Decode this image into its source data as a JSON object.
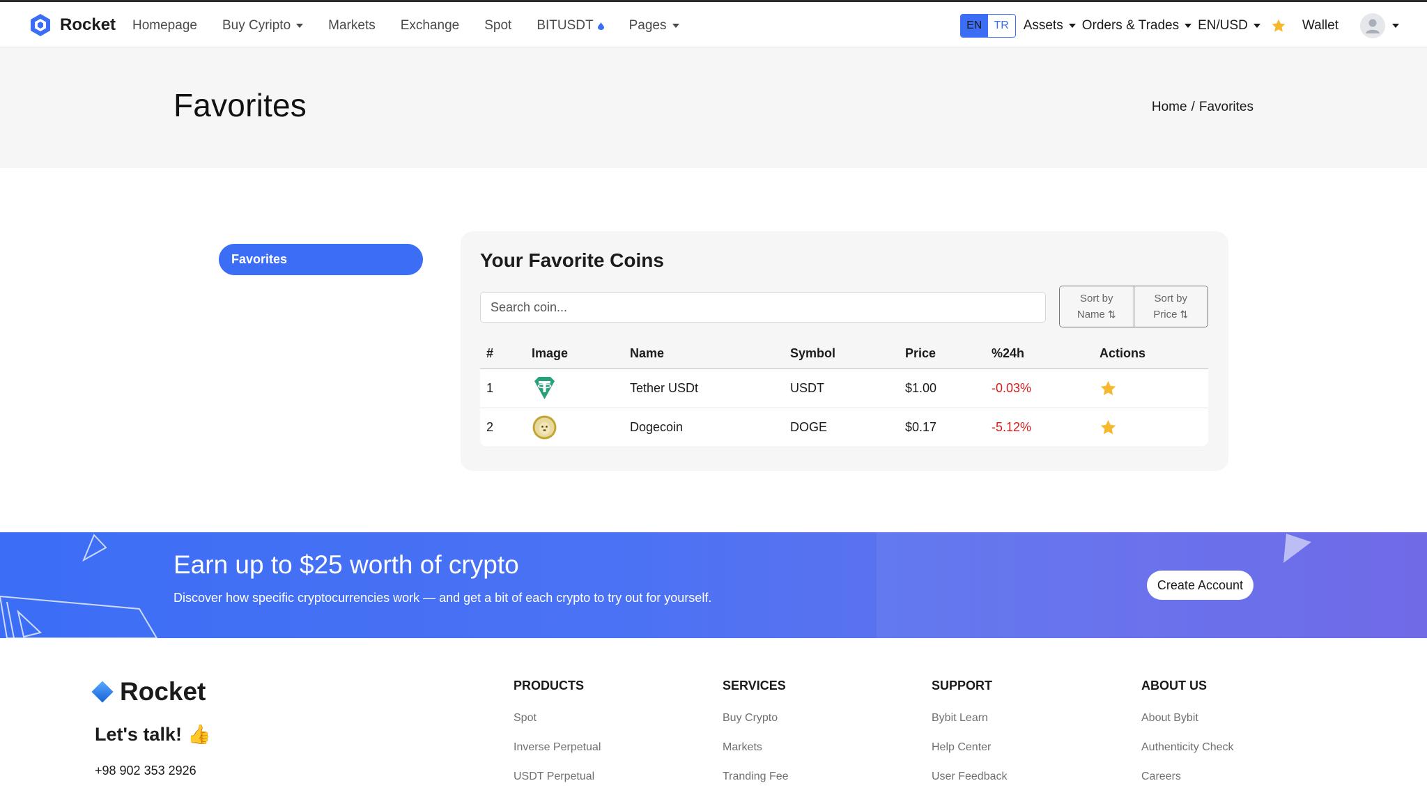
{
  "nav": {
    "brand": "Rocket",
    "links": [
      {
        "label": "Homepage",
        "dropdown": false
      },
      {
        "label": "Buy Cyripto",
        "dropdown": true
      },
      {
        "label": "Markets",
        "dropdown": false
      },
      {
        "label": "Exchange",
        "dropdown": false
      },
      {
        "label": "Spot",
        "dropdown": false
      },
      {
        "label": "BITUSDT",
        "dropdown": false
      },
      {
        "label": "Pages",
        "dropdown": true
      }
    ],
    "lang_en": "EN",
    "lang_tr": "TR",
    "assets": "Assets",
    "orders": "Orders & Trades",
    "currency": "EN/USD",
    "wallet": "Wallet"
  },
  "header": {
    "title": "Favorites",
    "breadcrumb_home": "Home",
    "breadcrumb_sep": "/",
    "breadcrumb_current": "Favorites"
  },
  "sidebar": {
    "active_label": "Favorites"
  },
  "card": {
    "title": "Your Favorite Coins",
    "search_placeholder": "Search coin...",
    "sort_name_line1": "Sort by",
    "sort_name_line2": "Name",
    "sort_price_line1": "Sort by",
    "sort_price_line2": "Price",
    "sort_symbol": "⇅",
    "columns": [
      "#",
      "Image",
      "Name",
      "Symbol",
      "Price",
      "%24h",
      "Actions"
    ],
    "rows": [
      {
        "num": "1",
        "image": "tether-icon",
        "name": "Tether USDt",
        "symbol": "USDT",
        "price": "$1.00",
        "change": "-0.03%"
      },
      {
        "num": "2",
        "image": "dogecoin-icon",
        "name": "Dogecoin",
        "symbol": "DOGE",
        "price": "$0.17",
        "change": "-5.12%"
      }
    ]
  },
  "promo": {
    "title": "Earn up to $25 worth of crypto",
    "subtitle": "Discover how specific cryptocurrencies work — and get a bit of each crypto to try out for yourself.",
    "button": "Create Account"
  },
  "footer": {
    "brand": "Rocket",
    "lets_talk": "Let's talk!",
    "emoji": "👍",
    "phone": "+98 902 353 2926",
    "columns": [
      {
        "title": "PRODUCTS",
        "links": [
          "Spot",
          "Inverse Perpetual",
          "USDT Perpetual"
        ]
      },
      {
        "title": "SERVICES",
        "links": [
          "Buy Crypto",
          "Markets",
          "Tranding Fee"
        ]
      },
      {
        "title": "SUPPORT",
        "links": [
          "Bybit Learn",
          "Help Center",
          "User Feedback"
        ]
      },
      {
        "title": "ABOUT US",
        "links": [
          "About Bybit",
          "Authenticity Check",
          "Careers"
        ]
      }
    ]
  },
  "colors": {
    "accent": "#3b6ef5",
    "negative": "#d81b1b",
    "star": "#f5b82e"
  }
}
